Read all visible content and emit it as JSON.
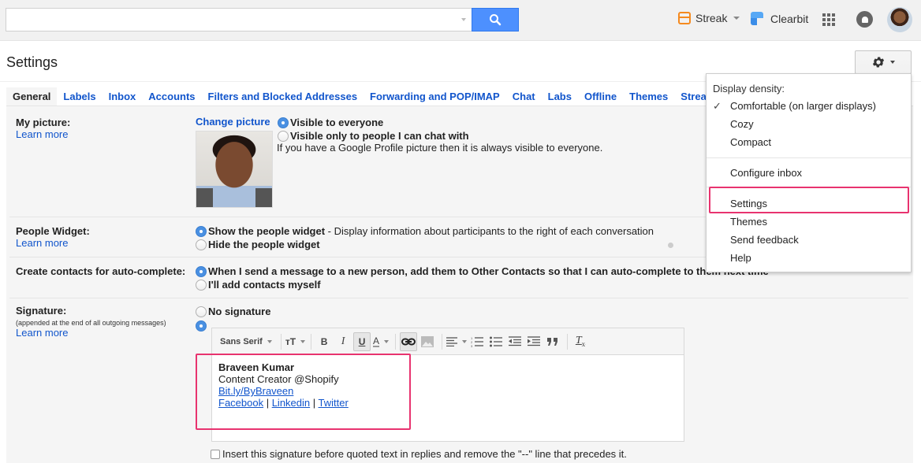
{
  "topbar": {
    "search": {
      "value": "",
      "placeholder": ""
    },
    "streak_label": "Streak",
    "clearbit_label": "Clearbit"
  },
  "header": {
    "title": "Settings"
  },
  "tabs": [
    {
      "label": "General",
      "active": true
    },
    {
      "label": "Labels"
    },
    {
      "label": "Inbox"
    },
    {
      "label": "Accounts"
    },
    {
      "label": "Filters and Blocked Addresses"
    },
    {
      "label": "Forwarding and POP/IMAP"
    },
    {
      "label": "Chat"
    },
    {
      "label": "Labs"
    },
    {
      "label": "Offline"
    },
    {
      "label": "Themes"
    },
    {
      "label": "Streak"
    }
  ],
  "settings": {
    "my_picture": {
      "label": "My picture:",
      "learn_more": "Learn more",
      "change_picture": "Change picture",
      "options": [
        "Visible to everyone",
        "Visible only to people I can chat with"
      ],
      "selected": 0,
      "note": "If you have a Google Profile picture then it is always visible to everyone."
    },
    "people_widget": {
      "label": "People Widget:",
      "learn_more": "Learn more",
      "option_show": "Show the people widget",
      "option_show_desc": " - Display information about participants to the right of each conversation",
      "option_hide": "Hide the people widget",
      "selected": 0
    },
    "auto_complete": {
      "label": "Create contacts for auto-complete:",
      "option_1": "When I send a message to a new person, add them to Other Contacts so that I can auto-complete to them next time",
      "option_2": "I'll add contacts myself",
      "selected": 0
    },
    "signature": {
      "label": "Signature:",
      "sub_note": "(appended at the end of all outgoing messages)",
      "learn_more": "Learn more",
      "no_signature": "No signature",
      "selected": 1,
      "toolbar": {
        "font": "Sans Serif",
        "bold": "B",
        "italic": "I",
        "underline": "U",
        "text_color": "A",
        "clear_format": "T"
      },
      "body": {
        "name": "Braveen Kumar",
        "title": "Content Creator @Shopify",
        "link": "Bit.ly/ByBraveen",
        "social": [
          "Facebook",
          "Linkedin",
          "Twitter"
        ],
        "separator": " | "
      },
      "insert_before_quoted": "Insert this signature before quoted text in replies and remove the \"--\" line that precedes it."
    }
  },
  "menu": {
    "heading": "Display density:",
    "density_options": [
      "Comfortable (on larger displays)",
      "Cozy",
      "Compact"
    ],
    "density_selected": 0,
    "check": "✓",
    "items": [
      "Configure inbox",
      "Settings",
      "Themes",
      "Send feedback",
      "Help"
    ],
    "highlighted_item": "Settings"
  },
  "colors": {
    "link": "#1155cc",
    "search_button": "#4d90fe",
    "highlight": "#e8336f",
    "streak": "#f58a1f"
  }
}
